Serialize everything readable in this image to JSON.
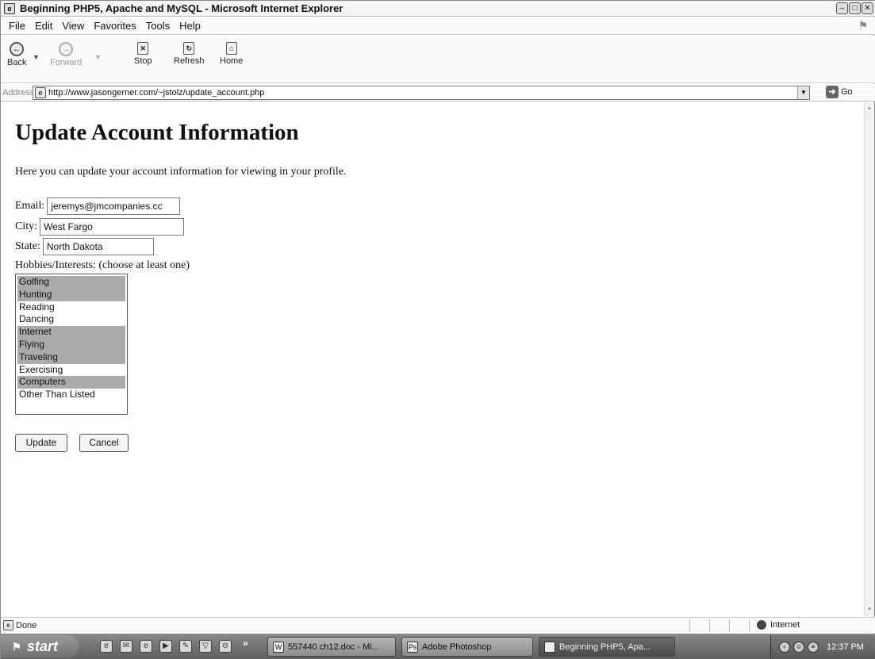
{
  "window": {
    "title": "Beginning PHP5, Apache and MySQL - Microsoft Internet Explorer",
    "icons": [
      "ie-icon",
      "minimize-icon",
      "maximize-icon",
      "close-icon"
    ]
  },
  "menu": {
    "items": [
      "File",
      "Edit",
      "View",
      "Favorites",
      "Tools",
      "Help"
    ]
  },
  "toolbar": {
    "back_label": "Back",
    "forward_label": "Forward",
    "stop_label": "Stop",
    "refresh_label": "Refresh",
    "home_label": "Home"
  },
  "address": {
    "label": "Address",
    "url": "http://www.jasongerner.com/~jstolz/update_account.php",
    "go_label": "Go"
  },
  "page": {
    "title": "Update Account Information",
    "intro": "Here you can update your account information for viewing in your profile.",
    "email_label": "Email:",
    "email_value": "jeremys@jmcompanies.cc",
    "city_label": "City:",
    "city_value": "West Fargo",
    "state_label": "State:",
    "state_value": "North Dakota",
    "hobbies_label": "Hobbies/Interests: (choose at least one)",
    "hobbies": [
      {
        "label": "Golfing",
        "selected": true
      },
      {
        "label": "Hunting",
        "selected": true
      },
      {
        "label": "Reading",
        "selected": false
      },
      {
        "label": "Dancing",
        "selected": false
      },
      {
        "label": "Internet",
        "selected": true
      },
      {
        "label": "Flying",
        "selected": true
      },
      {
        "label": "Traveling",
        "selected": true
      },
      {
        "label": "Exercising",
        "selected": false
      },
      {
        "label": "Computers",
        "selected": true
      },
      {
        "label": "Other Than Listed",
        "selected": false
      }
    ],
    "update_label": "Update",
    "cancel_label": "Cancel"
  },
  "status": {
    "text": "Done",
    "zone": "Internet"
  },
  "taskbar": {
    "start_label": "start",
    "more_label": "»",
    "tasks": [
      {
        "label": "557440 ch12.doc - Mi..."
      },
      {
        "label": "Adobe Photoshop"
      },
      {
        "label": "Beginning PHP5, Apa..."
      }
    ],
    "clock": "12:37 PM"
  }
}
